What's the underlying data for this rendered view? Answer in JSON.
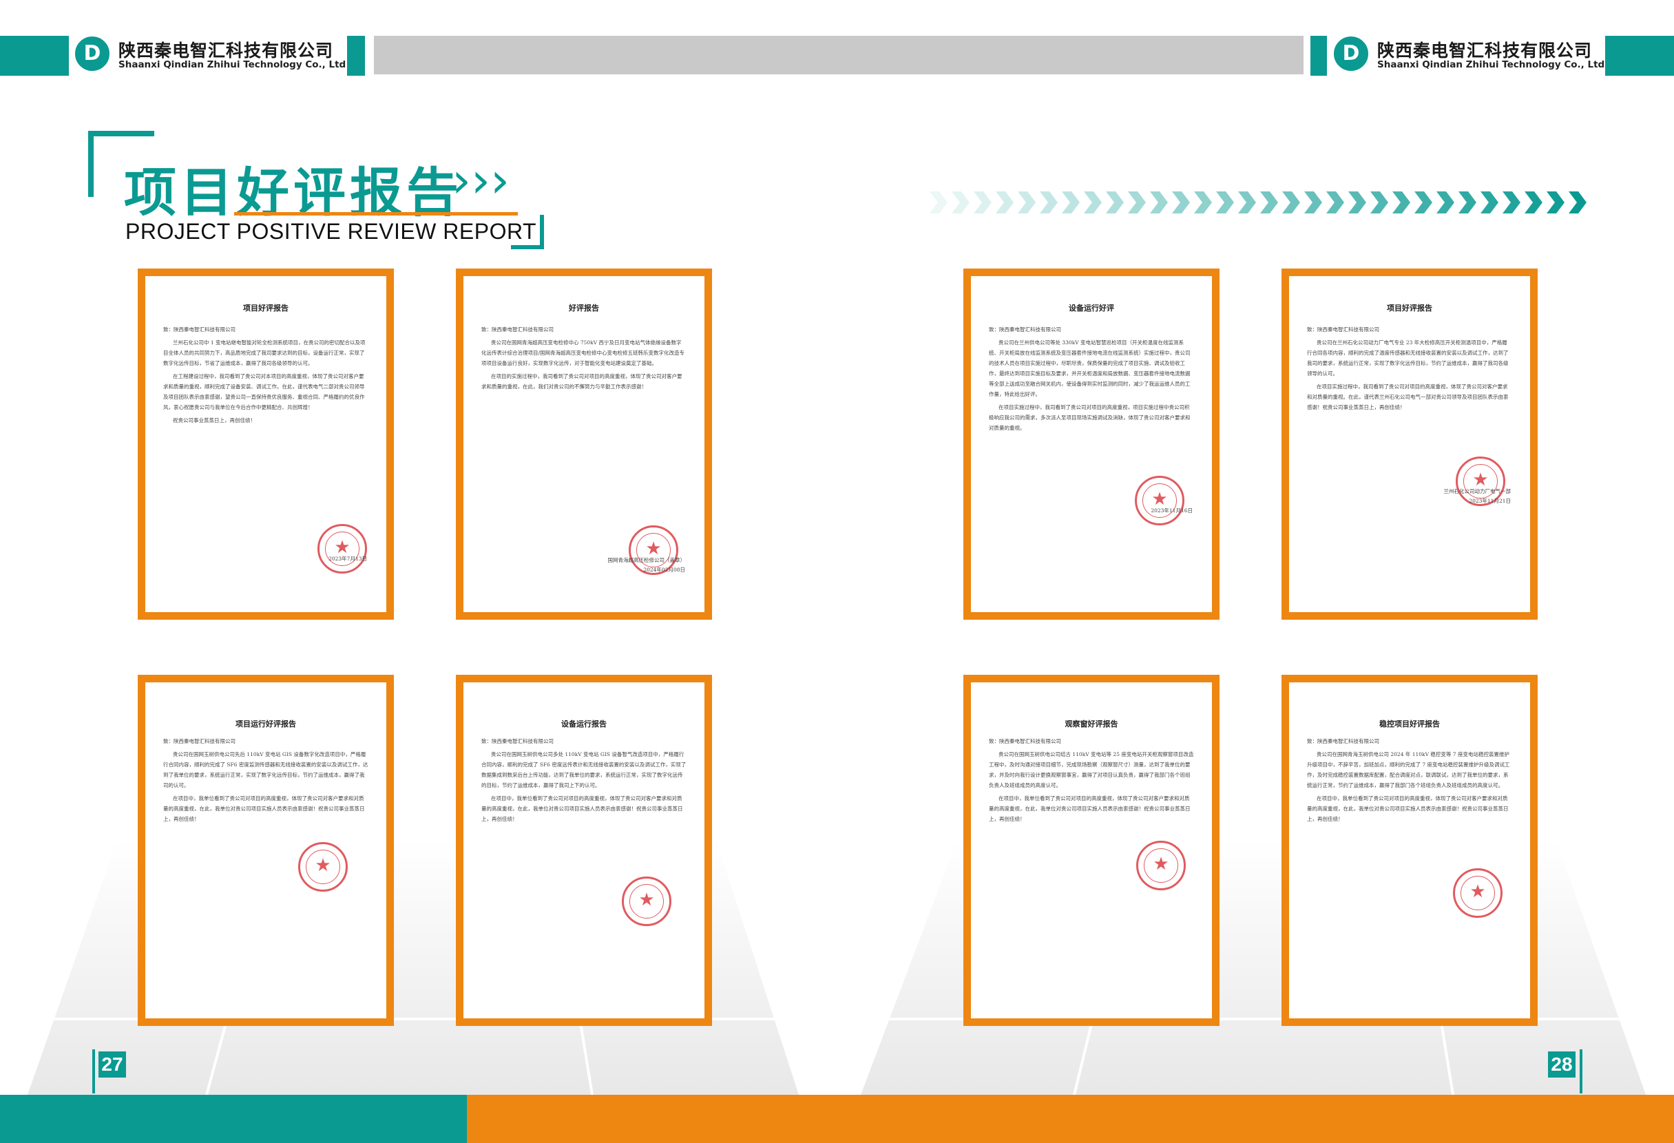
{
  "header": {
    "company_cn": "陕西秦电智汇科技有限公司",
    "company_en": "Shaanxi Qindian Zhihui Technology Co., Ltd",
    "logo_letter": "D"
  },
  "title": {
    "cn": "项目好评报告",
    "en": "PROJECT POSITIVE REVIEW REPORT",
    "arrows": "›››"
  },
  "colors": {
    "teal": "#0a9a92",
    "orange": "#ee8612",
    "gray": "#c9c9c9",
    "seal_red": "#d6252b"
  },
  "letters": [
    {
      "title": "项目好评报告",
      "salutation": "致：陕西秦电智汇科技有限公司",
      "paragraphs": [
        "兰州石化公司中 1 变电站继电智能对轮全检测系统项目，在贵公司的密切配合以及项目全体人员的共同努力下，高品质地完成了我司要求达到的目标，设备运行正常，实现了数字化远传目标，节省了运维成本，赢得了我司各级领导的认可。",
        "在工程建设过程中，我司看到了贵公司对本项目的高度重视，体现了贵公司对客户要求和质量的重视，顺利完成了设备安装、调试工作。在此，谨代表电气二部对贵公司领导及项目团队表示由衷感谢，望贵公司一直保持贵优良服务、重视合同、严格履约的优良作风，衷心祝愿贵公司与我单位在今后合作中更精配合、共创辉煌！",
        "祝贵公司事业蒸蒸日上，再创佳绩！"
      ],
      "signature": "2023年7月13日"
    },
    {
      "title": "好评报告",
      "salutation": "致：陕西秦电智汇科技有限公司",
      "paragraphs": [
        "贵公司在国网青海超高压变电检修中心 750kV 西宁及日月变电站气体绝缘设备数字化远传表计综合治理项目/国网青海超高压变电检修中心变电检修五班韩乐变数字化改造专项项目设备运行良好，实现数字化远传，对于智能化变电站建设奠定了基础。",
        "在项目的实施过程中，我司看到了贵公司对项目的高度重视，体现了贵公司对客户要求和质量的重视，在此，我们对贵公司的不懈努力与辛勤工作表示感谢！"
      ],
      "signature": "国网青海超高压检修公司（盖章）\n2024年02月08日"
    },
    {
      "title": "设备运行好评",
      "salutation": "致：陕西秦电智汇科技有限公司",
      "paragraphs": [
        "贵公司在兰州供电公司等处 330kV 变电站智慧巡检项目（开关柜温度在线监测系统、开关柜局放在线监测系统及变压器套件接地电流在线监测系统）实施过程中，贵公司的技术人员在项目实施过程中，尽职尽责，保质保量的完成了项目实施、调试及验收工作，最终达到项目实施目标及要求，并开关柜温度和局放数据、变压器套件接地电流数据等全部上送成功至融合网关机内，使设备得到实时监测的同时，减少了我运运维人员的工作量，特此给出好评。",
        "在项目实施过程中，我司看到了贵公司对项目的高度重视，项目实施过程中贵公司积极响应我公司的需求，多次派人至项目现场实施调试及消缺，体现了贵公司对客户要求和对质量的重视。"
      ],
      "signature": "2023年11月16日"
    },
    {
      "title": "项目好评报告",
      "salutation": "致：陕西秦电智汇科技有限公司",
      "paragraphs": [
        "贵公司在兰州石化公司动力厂电气专业 23 年大检修高压开关柜测温项目中，严格履行合同各项内容，顺利的完成了温度传感器和无线接收装置的安装以及调试工作，达到了我司的要求，系统运行正常，实现了数字化远传目标，节约了运维成本，赢得了我司各级领导的认可。",
        "在项目实施过程中，我司看到了贵公司对项目的高度重视，体现了贵公司对客户要求和对质量的重视。在此，谨代表兰州石化公司电气一部对贵公司领导及项目团队表示由衷感谢！祝贵公司事业蒸蒸日上，再创佳绩！"
      ],
      "signature": "兰州石化公司动力厂电气一部\n2023年11月21日"
    },
    {
      "title": "项目运行好评报告",
      "salutation": "致：陕西秦电智汇科技有限公司",
      "paragraphs": [
        "贵公司在国网玉树供电公司先后 110kV 变电站 GIS 设备数字化改造项目中，严格履行合同内容，顺利的完成了 SF6 密度监测传感器和无线接收装置的安装以及调试工作，达到了我单位的要求，系统运行正常，实现了数字化远传目标，节约了运维成本，赢得了我司的认可。",
        "在项目中，我单位看到了贵公司对项目的高度重视，体现了贵公司对客户要求和对质量的高度重视，在此，我单位对贵公司项目实施人员表示由衷感谢！祝贵公司事业蒸蒸日上，再创佳绩！"
      ],
      "signature": ""
    },
    {
      "title": "设备运行报告",
      "salutation": "致：陕西秦电智汇科技有限公司",
      "paragraphs": [
        "贵公司在国网玉树供电公司多处 110kV 变电站 GIS 设备智气改造项目中，严格履行合同内容，顺利的完成了 SF6 密度远传表计和无线接收装置的安装以及调试工作，实现了数据集成到数采后台上传功能，达到了我单位的要求，系统运行正常，实现了数字化远传的目标，节约了运维成本，赢得了我司上下的认可。",
        "在项目中，我单位看到了贵公司对项目的高度重视，体现了贵公司对客户要求和对质量的高度重视，在此，我单位对贵公司项目实施人员表示由衷感谢！祝贵公司事业蒸蒸日上，再创佳绩！"
      ],
      "signature": ""
    },
    {
      "title": "观察窗好评报告",
      "salutation": "致：陕西秦电智汇科技有限公司",
      "paragraphs": [
        "贵公司在国网玉树供电公司结古 110kV 变电站等 25 座变电站开关柜观察窗项目改造工程中，及时沟通对接项目细节，完成现场勘察（观察窗尺寸）测量，达到了我单位的要求，并及时向我行设计更换观察窗事宜，赢得了对项目认真负责，赢得了我部门各个班组负责人及班组成员的高度认可。",
        "在项目中，我单位看到了贵公司对项目的高度重视，体现了贵公司对客户要求和对质量的高度重视，在此，我单位对贵公司项目实施人员表示由衷感谢！祝贵公司事业蒸蒸日上，再创佳绩！"
      ],
      "signature": ""
    },
    {
      "title": "稳控项目好评报告",
      "salutation": "致：陕西秦电智汇科技有限公司",
      "paragraphs": [
        "贵公司在国网青海玉树供电公司 2024 年 110kV 稳控变等 7 座变电站稳控装置维护升级项目中，不辞辛苦，加班加点，顺利的完成了 7 座变电站稳控装置维护升级及调试工作，及时完成稳控装置数据库配置，配合调度对点，联调联试，达到了我单位的要求，系统运行正常，节约了运维成本，赢得了我部门各个班组负责人及班组成员的高度认可。",
        "在项目中，我单位看到了贵公司对项目的高度重视，体现了贵公司对客户要求和对质量的高度重视，在此，我单位对贵公司项目实施人员表示由衷感谢！祝贵公司事业蒸蒸日上，再创佳绩！"
      ],
      "signature": ""
    }
  ],
  "pages": {
    "left": "27",
    "right": "28"
  }
}
